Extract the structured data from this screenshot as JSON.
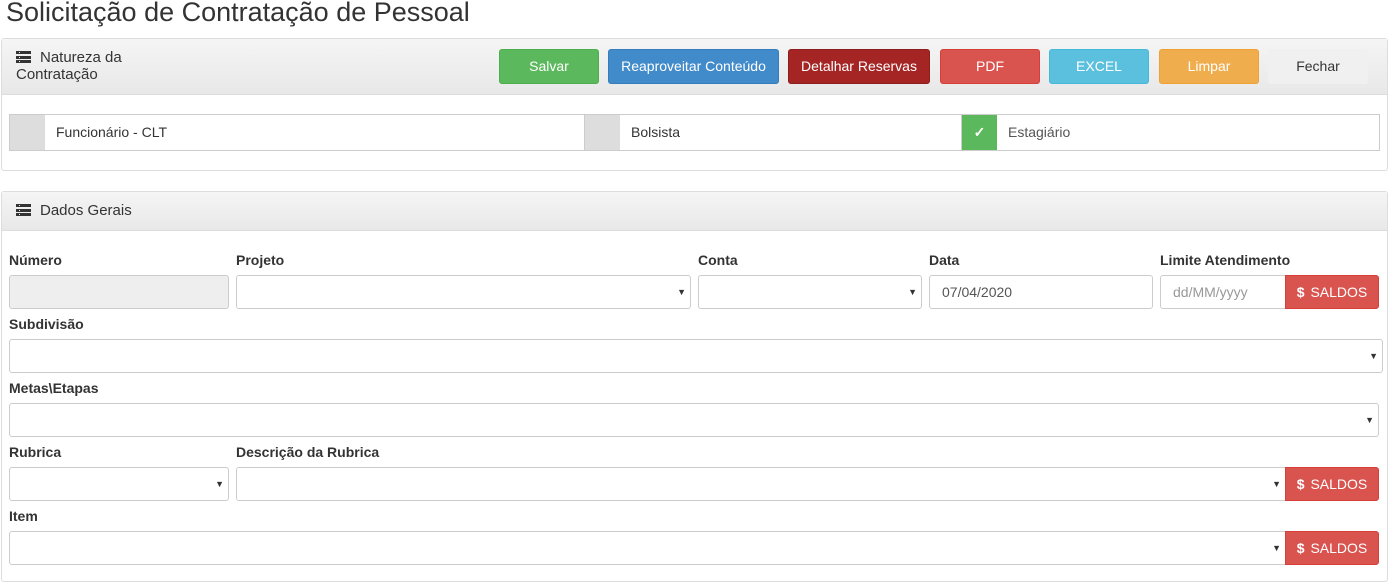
{
  "page": {
    "title": "Solicitação de Contratação de Pessoal"
  },
  "natureza": {
    "title": "Natureza da Contratação",
    "icon": "list-icon",
    "buttons": {
      "salvar": "Salvar",
      "reaproveitar": "Reaproveitar Conteúdo",
      "detalhar": "Detalhar Reservas",
      "pdf": "PDF",
      "excel": "EXCEL",
      "limpar": "Limpar",
      "fechar": "Fechar"
    },
    "options": [
      {
        "label": "Funcionário - CLT",
        "checked": false
      },
      {
        "label": "Bolsista",
        "checked": false
      },
      {
        "label": "Estagiário",
        "checked": true,
        "check_glyph": "✓"
      }
    ]
  },
  "dados": {
    "title": "Dados Gerais",
    "icon": "list-icon",
    "fields": {
      "numero": {
        "label": "Número",
        "value": ""
      },
      "projeto": {
        "label": "Projeto",
        "value": ""
      },
      "conta": {
        "label": "Conta",
        "value": ""
      },
      "data": {
        "label": "Data",
        "value": "07/04/2020"
      },
      "limite": {
        "label": "Limite Atendimento",
        "placeholder": "dd/MM/yyyy"
      },
      "subdivisao": {
        "label": "Subdivisão",
        "value": ""
      },
      "metas": {
        "label": "Metas\\Etapas",
        "value": ""
      },
      "rubrica": {
        "label": "Rubrica",
        "value": ""
      },
      "descricao": {
        "label": "Descrição da Rubrica",
        "value": ""
      },
      "item": {
        "label": "Item",
        "value": ""
      }
    },
    "saldos": {
      "symbol": "$",
      "label": "SALDOS"
    },
    "caret": "▼"
  },
  "colors": {
    "success": "#5cb85c",
    "primary": "#428bca",
    "dark_red": "#a52525",
    "danger": "#d9534f",
    "info": "#5bc0de",
    "warning": "#f0ad4e"
  }
}
